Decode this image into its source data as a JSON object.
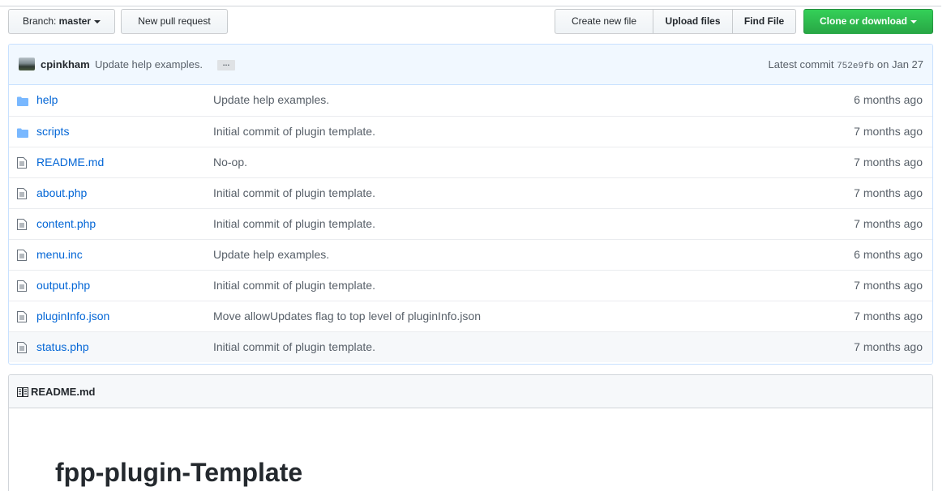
{
  "toolbar": {
    "branch_prefix": "Branch: ",
    "branch_name": "master",
    "new_pull_request": "New pull request",
    "create_new_file": "Create new file",
    "upload_files": "Upload files",
    "find_file": "Find File",
    "clone_or_download": "Clone or download"
  },
  "commit": {
    "author": "cpinkham",
    "message": "Update help examples.",
    "ellipsis": "…",
    "latest_prefix": "Latest commit ",
    "sha": "752e9fb",
    "date": " on Jan 27"
  },
  "files": [
    {
      "name": "help",
      "type": "folder",
      "message": "Update help examples.",
      "age": "6 months ago"
    },
    {
      "name": "scripts",
      "type": "folder",
      "message": "Initial commit of plugin template.",
      "age": "7 months ago"
    },
    {
      "name": "README.md",
      "type": "file",
      "message": "No-op.",
      "age": "7 months ago"
    },
    {
      "name": "about.php",
      "type": "file",
      "message": "Initial commit of plugin template.",
      "age": "7 months ago"
    },
    {
      "name": "content.php",
      "type": "file",
      "message": "Initial commit of plugin template.",
      "age": "7 months ago"
    },
    {
      "name": "menu.inc",
      "type": "file",
      "message": "Update help examples.",
      "age": "6 months ago"
    },
    {
      "name": "output.php",
      "type": "file",
      "message": "Initial commit of plugin template.",
      "age": "7 months ago"
    },
    {
      "name": "pluginInfo.json",
      "type": "file",
      "message": "Move allowUpdates flag to top level of pluginInfo.json",
      "age": "7 months ago"
    },
    {
      "name": "status.php",
      "type": "file",
      "message": "Initial commit of plugin template.",
      "age": "7 months ago"
    }
  ],
  "readme": {
    "header": "README.md",
    "heading": "fpp-plugin-Template"
  },
  "colors": {
    "link": "#0366d6",
    "clone_button": "#28a745",
    "commit_bar": "#f1f8ff"
  }
}
